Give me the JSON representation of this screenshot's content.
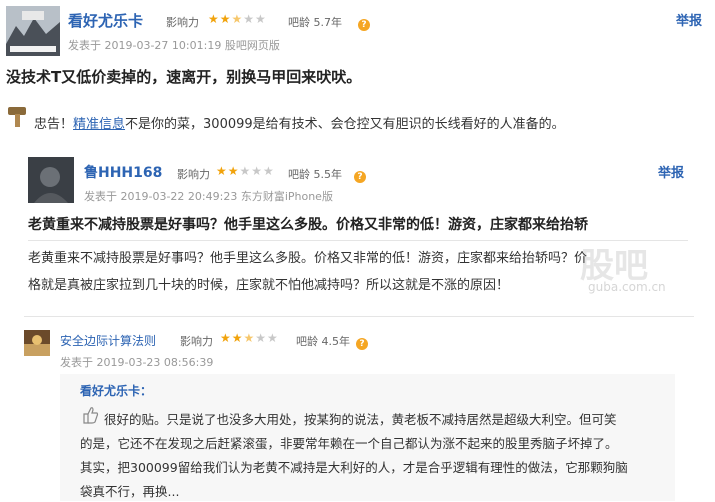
{
  "post": {
    "author": "看好尤乐卡",
    "influence_label": "影响力",
    "influence_stars": 2.5,
    "age_label": "吧龄 5.7年",
    "posted": "发表于 2019-03-27 10:01:19 股吧网页版",
    "report": "举报",
    "title": "没技术T又低价卖掉的，速离开，别换马甲回来吠吠。",
    "body": {
      "prefix": "忠告！",
      "link": "精准信息",
      "suffix": "不是你的菜，300099是给有技术、会仓控又有胆识的长线看好的人准备的。"
    }
  },
  "quote": {
    "author": "鲁HHH168",
    "influence_label": "影响力",
    "influence_stars": 2,
    "age_label": "吧龄 5.5年",
    "posted": "发表于 2019-03-22 20:49:23 东方财富iPhone版",
    "report": "举报",
    "title": "老黄重来不减持股票是好事吗？他手里这么多股。价格又非常的低！游资，庄家都来给抬轿",
    "body_line1": "老黄重来不减持股票是好事吗？他手里这么多股。价格又非常的低！游资，庄家都来给抬轿吗？价",
    "body_line2": "格就是真被庄家拉到几十块的时候，庄家就不怕他减持吗？所以这就是不涨的原因！",
    "watermark": "股吧",
    "watermark_url": "guba.com.cn"
  },
  "reply": {
    "author": "安全边际计算法则",
    "influence_label": "影响力",
    "influence_stars": 2.5,
    "age_label": "吧龄 4.5年",
    "posted": "发表于 2019-03-23 08:56:39",
    "quoted_author": "看好尤乐卡：",
    "line1": "很好的贴。只是说了也没多大用处，按某狗的说法，黄老板不减持居然是超级大利空。但可笑",
    "line2": "的是，它还不在发现之后赶紧滚蛋，非要常年赖在一个自己都认为涨不起来的股里秀脑子坏掉了。",
    "line3": "其实，把300099留给我们认为老黄不减持是大利好的人，才是合乎逻辑有理性的做法，它那颗狗脑",
    "line4": "袋真不行，再换..."
  },
  "colors": {
    "link": "#2d64b3",
    "star": "#f1a30c",
    "star_empty": "#c8c8c8",
    "help": "#f5a623"
  },
  "icons": [
    "help-icon",
    "warning-hammer-icon",
    "thumbs-up-icon"
  ]
}
